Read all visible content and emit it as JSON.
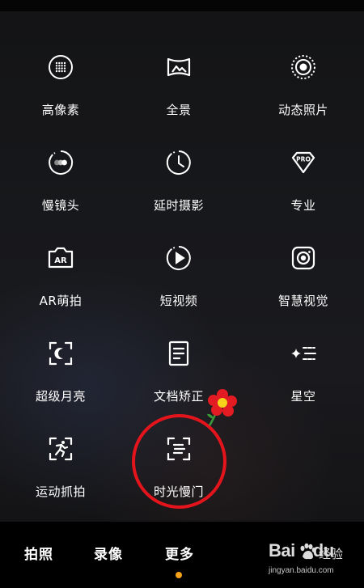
{
  "modes": [
    {
      "label": "高像素",
      "icon": "high-pixel-icon"
    },
    {
      "label": "全景",
      "icon": "panorama-icon"
    },
    {
      "label": "动态照片",
      "icon": "live-photo-icon"
    },
    {
      "label": "慢镜头",
      "icon": "slow-motion-icon"
    },
    {
      "label": "延时摄影",
      "icon": "timelapse-icon"
    },
    {
      "label": "专业",
      "icon": "pro-icon",
      "icon_text": "PRO"
    },
    {
      "label": "AR萌拍",
      "icon": "ar-icon",
      "icon_text": "AR"
    },
    {
      "label": "短视频",
      "icon": "short-video-icon"
    },
    {
      "label": "智慧视觉",
      "icon": "smart-vision-icon"
    },
    {
      "label": "超级月亮",
      "icon": "super-moon-icon"
    },
    {
      "label": "文档矫正",
      "icon": "document-icon"
    },
    {
      "label": "星空",
      "icon": "starry-sky-icon"
    },
    {
      "label": "运动抓拍",
      "icon": "sport-capture-icon"
    },
    {
      "label": "时光慢门",
      "icon": "light-painting-icon"
    }
  ],
  "bottom_tabs": {
    "photo": "拍照",
    "video": "录像",
    "more": "更多"
  },
  "active_tab": "更多",
  "colors": {
    "accent": "#f6a21a",
    "highlight_circle": "#e3141b"
  },
  "watermark": {
    "logo": "Bai",
    "logo_tail": "du",
    "text": "经验",
    "url": "jingyan.baidu.com"
  }
}
